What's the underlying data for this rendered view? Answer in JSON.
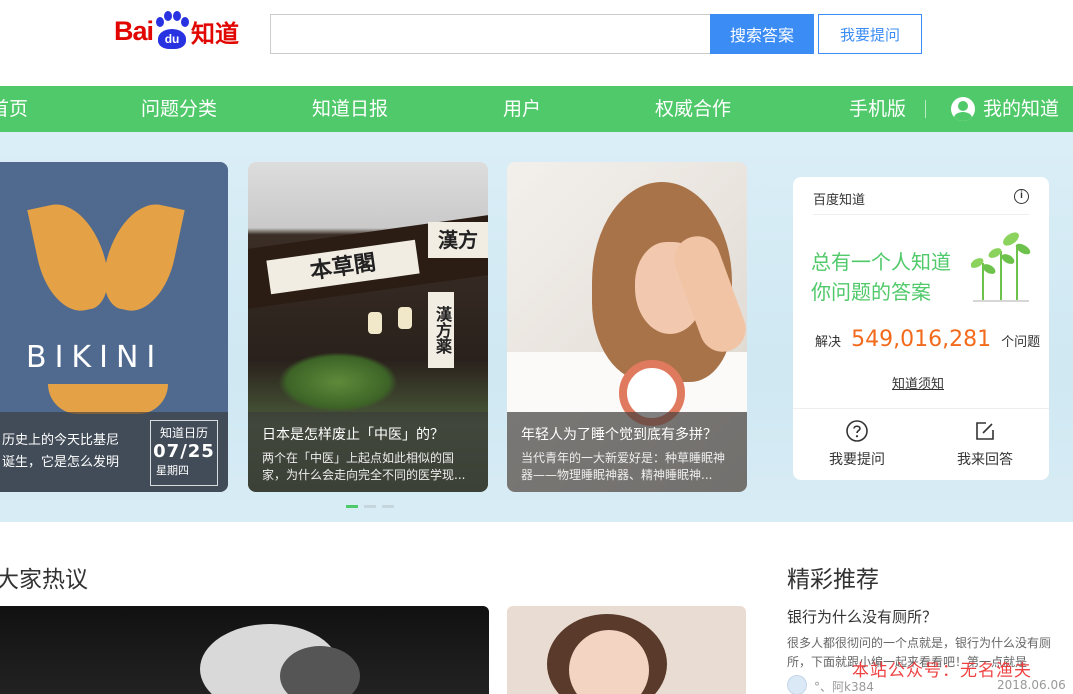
{
  "header": {
    "logo": {
      "bai": "Bai",
      "du": "du",
      "zhidao": "知道"
    },
    "search": {
      "value": "",
      "placeholder": "",
      "search_label": "搜索答案",
      "ask_label": "我要提问"
    }
  },
  "nav": {
    "items": [
      "首页",
      "问题分类",
      "知道日报",
      "用户",
      "权威合作",
      "手机版"
    ],
    "my_label": "我的知道"
  },
  "banner": {
    "cards": [
      {
        "image_text": "BIKINI",
        "caption_line1": "历史上的今天比基尼",
        "caption_line2": "诞生，它是怎么发明",
        "daily": {
          "label": "知道日历",
          "date": "07/25",
          "weekday": "星期四"
        }
      },
      {
        "title": "日本是怎样废止「中医」的？",
        "desc": "两个在「中医」上起点如此相似的国家，为什么会走向完全不同的医学现...",
        "signs": [
          "本草閣",
          "漢方",
          "漢方薬"
        ]
      },
      {
        "title": "年轻人为了睡个觉到底有多拼？",
        "desc": "当代青年的一大新爱好是：种草睡眠神器——物理睡眠神器、精神睡眠神..."
      }
    ],
    "pagination": {
      "total": 3,
      "active": 0
    }
  },
  "info_card": {
    "title": "百度知道",
    "slogan_line1": "总有一个人知道",
    "slogan_line2": "你问题的答案",
    "count_prefix": "解决",
    "count": "549,016,281",
    "count_suffix": "个问题",
    "guide_link": "知道须知",
    "ask_label": "我要提问",
    "answer_label": "我来回答"
  },
  "sections": {
    "hot_title": "大家热议",
    "rec_title": "精彩推荐"
  },
  "recommend": {
    "question": "银行为什么没有厕所？",
    "desc": "很多人都很彻问的一个点就是，银行为什么没有厕所，下面就跟小编一起来看看吧！第一点就是",
    "user": "°、阿k384",
    "date": "2018.06.06"
  },
  "watermark": "本站公众号：无名渔夫",
  "colors": {
    "brand_green": "#4fc969",
    "search_blue": "#3b8cf5",
    "count_orange": "#f26b1d",
    "logo_red": "#e10601",
    "logo_blue": "#2932e1"
  }
}
